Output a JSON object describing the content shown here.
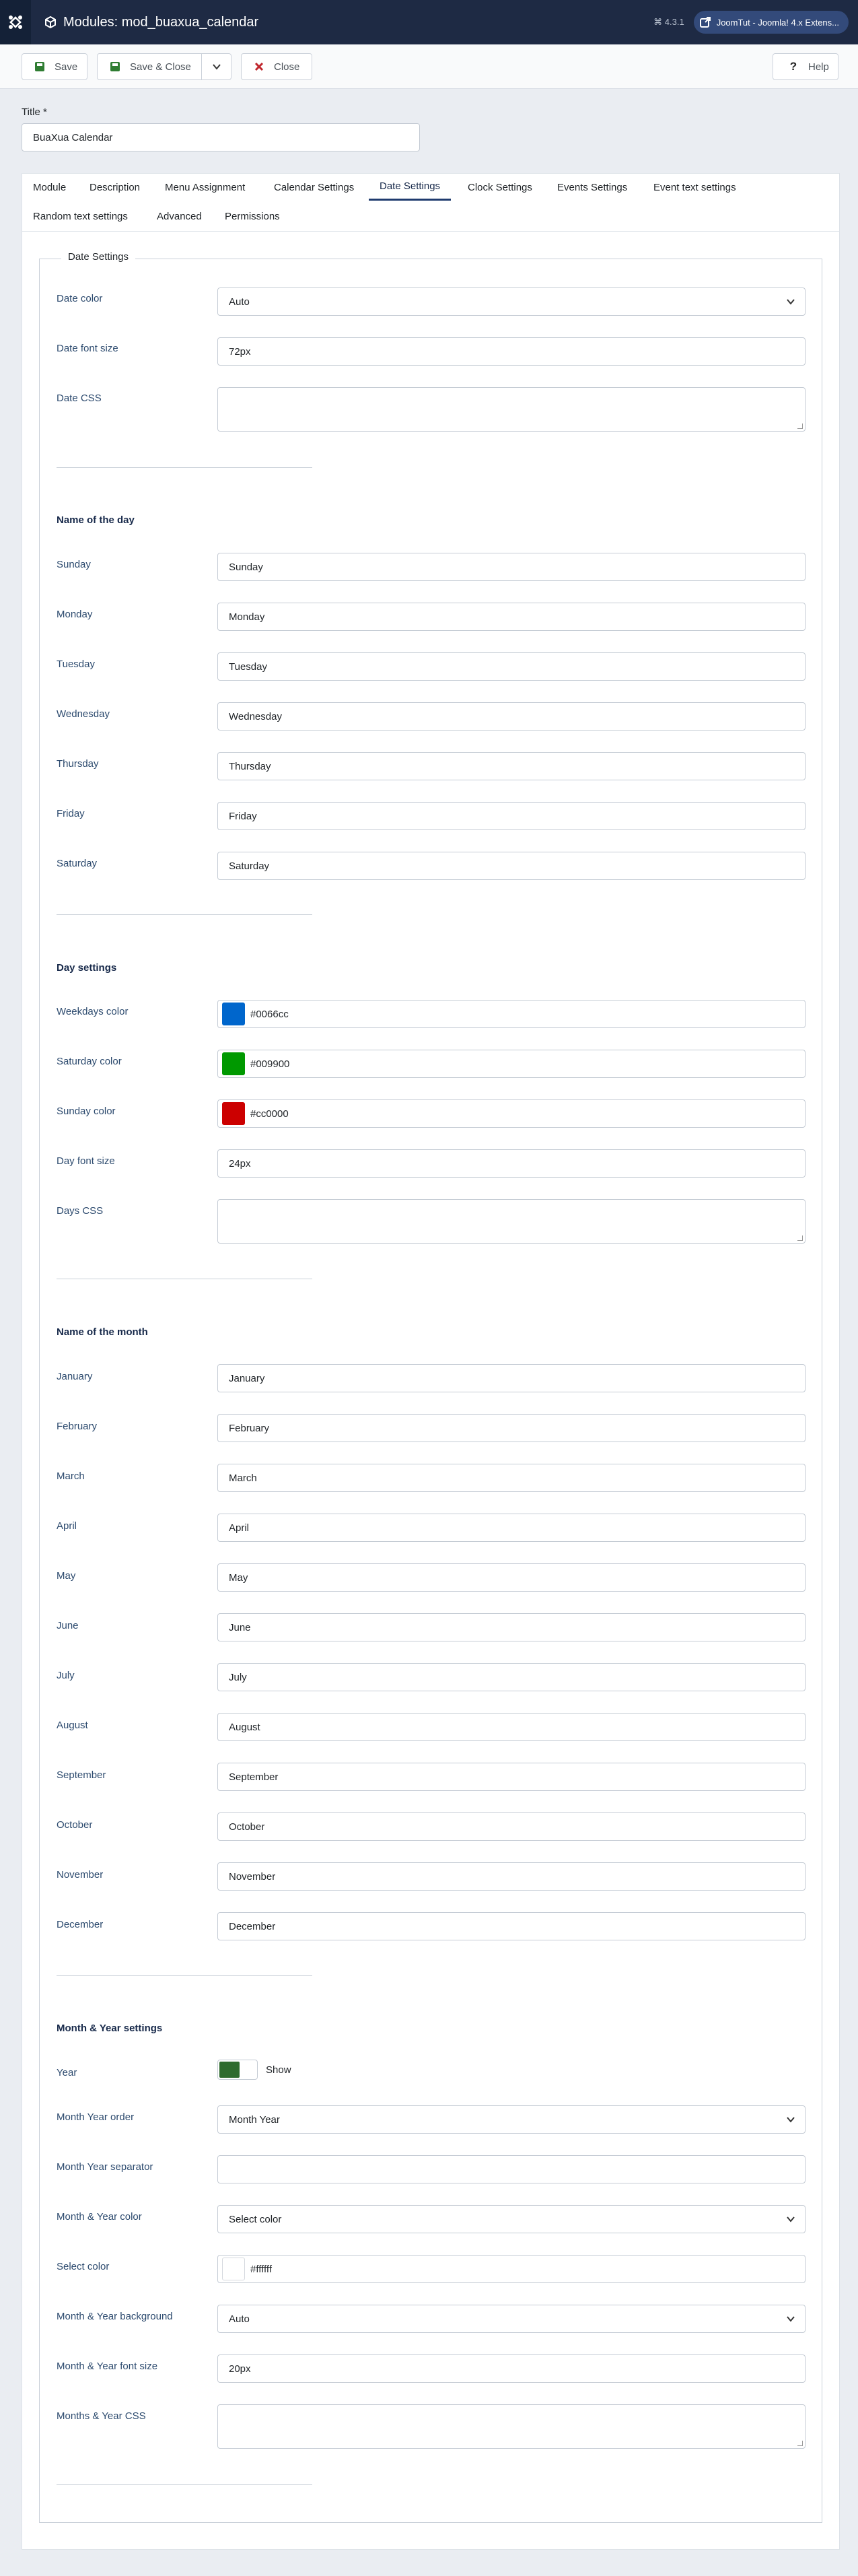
{
  "header": {
    "title": "Modules: mod_buaxua_calendar",
    "version": "⌘ 4.3.1",
    "extension_button": "JoomTut - Joomla! 4.x Extens..."
  },
  "toolbar": {
    "save": "Save",
    "save_close": "Save & Close",
    "close": "Close",
    "help": "Help"
  },
  "title_field": {
    "label": "Title *",
    "value": "BuaXua Calendar"
  },
  "tabs": [
    "Module",
    "Description",
    "Menu Assignment",
    "Calendar Settings",
    "Date Settings",
    "Clock Settings",
    "Events Settings",
    "Event text settings",
    "Random text settings",
    "Advanced",
    "Permissions"
  ],
  "active_tab": "Date Settings",
  "fieldset": {
    "legend": "Date Settings"
  },
  "date": {
    "color_label": "Date color",
    "color_value": "Auto",
    "font_size_label": "Date font size",
    "font_size_value": "72px",
    "css_label": "Date CSS",
    "css_value": ""
  },
  "day_names": {
    "section": "Name of the day",
    "items": [
      {
        "label": "Sunday",
        "value": "Sunday"
      },
      {
        "label": "Monday",
        "value": "Monday"
      },
      {
        "label": "Tuesday",
        "value": "Tuesday"
      },
      {
        "label": "Wednesday",
        "value": "Wednesday"
      },
      {
        "label": "Thursday",
        "value": "Thursday"
      },
      {
        "label": "Friday",
        "value": "Friday"
      },
      {
        "label": "Saturday",
        "value": "Saturday"
      }
    ]
  },
  "day_settings": {
    "section": "Day settings",
    "weekdays_label": "Weekdays color",
    "weekdays_value": "#0066cc",
    "saturday_label": "Saturday color",
    "saturday_value": "#009900",
    "sunday_label": "Sunday color",
    "sunday_value": "#cc0000",
    "font_size_label": "Day font size",
    "font_size_value": "24px",
    "css_label": "Days CSS"
  },
  "month_names": {
    "section": "Name of the month",
    "items": [
      {
        "label": "January",
        "value": "January"
      },
      {
        "label": "February",
        "value": "February"
      },
      {
        "label": "March",
        "value": "March"
      },
      {
        "label": "April",
        "value": "April"
      },
      {
        "label": "May",
        "value": "May"
      },
      {
        "label": "June",
        "value": "June"
      },
      {
        "label": "July",
        "value": "July"
      },
      {
        "label": "August",
        "value": "August"
      },
      {
        "label": "September",
        "value": "September"
      },
      {
        "label": "October",
        "value": "October"
      },
      {
        "label": "November",
        "value": "November"
      },
      {
        "label": "December",
        "value": "December"
      }
    ]
  },
  "month_year": {
    "section": "Month & Year settings",
    "year_label": "Year",
    "year_toggle": "Show",
    "order_label": "Month Year order",
    "order_value": "Month Year",
    "separator_label": "Month Year separator",
    "separator_value": "",
    "color_label": "Month & Year color",
    "color_value": "Select color",
    "select_color_label": "Select color",
    "select_color_value": "#ffffff",
    "background_label": "Month & Year background",
    "background_value": "Auto",
    "font_size_label": "Month & Year font size",
    "font_size_value": "20px",
    "css_label": "Months & Year CSS"
  },
  "colors": {
    "header_bg": "#1e2a44",
    "weekdays": "#0066cc",
    "saturday": "#009900",
    "sunday": "#cc0000",
    "select_color": "#ffffff",
    "toggle_on": "#2e6b2e"
  }
}
